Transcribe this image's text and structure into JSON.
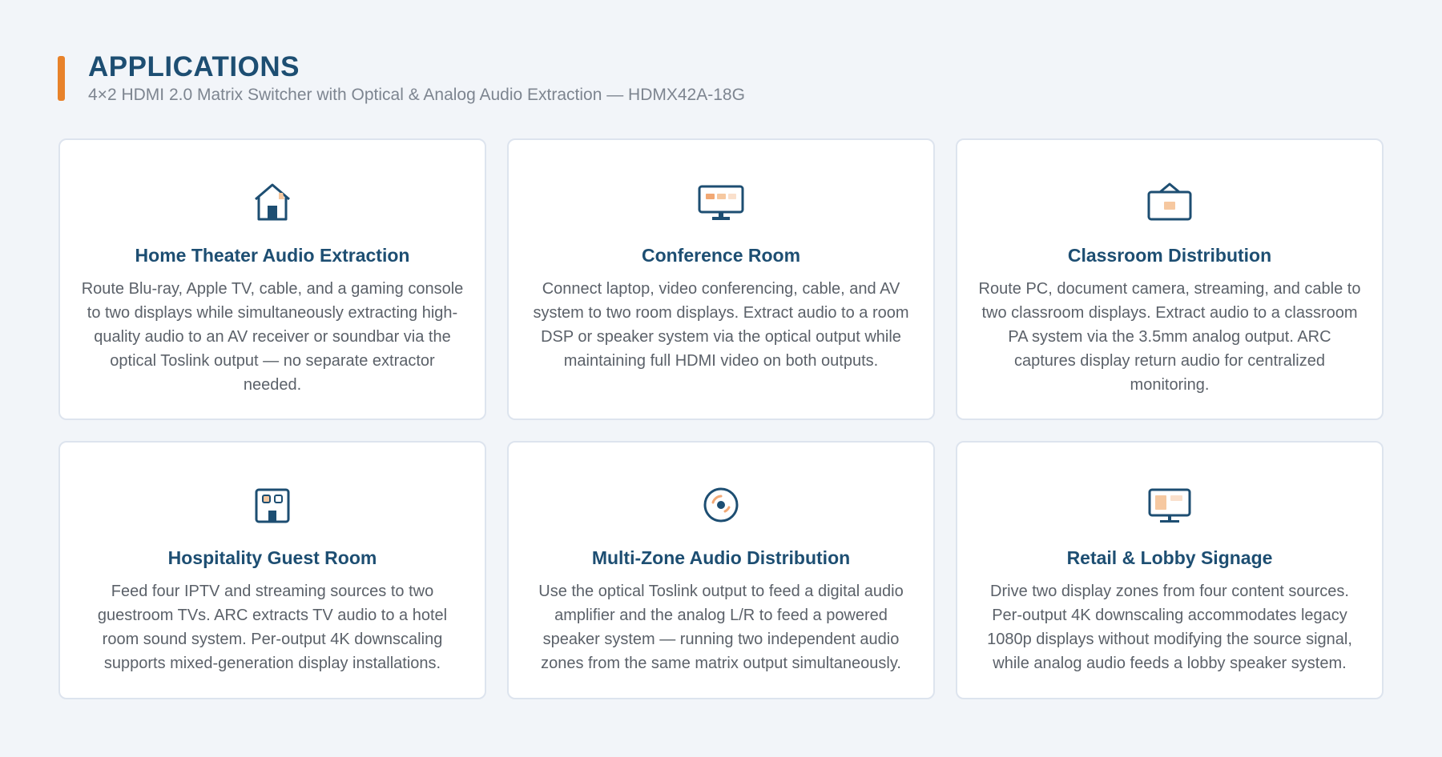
{
  "header": {
    "title": "APPLICATIONS",
    "subtitle": "4×2 HDMI 2.0 Matrix Switcher with Optical & Analog Audio Extraction — HDMX42A-18G"
  },
  "colors": {
    "accent": "#e8822a",
    "navy": "#1d4e72",
    "icon_fill": "#f6c8a0"
  },
  "cards": [
    {
      "icon": "home-icon",
      "title": "Home Theater Audio Extraction",
      "description": "Route Blu-ray, Apple TV, cable, and a gaming console to two displays while simultaneously extracting high-quality audio to an AV receiver or soundbar via the optical Toslink output — no separate extractor needed."
    },
    {
      "icon": "monitor-icon",
      "title": "Conference Room",
      "description": "Connect laptop, video conferencing, cable, and AV system to two room displays. Extract audio to a room DSP or speaker system via the optical output while maintaining full HDMI video on both outputs."
    },
    {
      "icon": "wall-board-icon",
      "title": "Classroom Distribution",
      "description": "Route PC, document camera, streaming, and cable to two classroom displays. Extract audio to a classroom PA system via the 3.5mm analog output. ARC captures display return audio for centralized monitoring."
    },
    {
      "icon": "hotel-icon",
      "title": "Hospitality Guest Room",
      "description": "Feed four IPTV and streaming sources to two guestroom TVs. ARC extracts TV audio to a hotel room sound system. Per-output 4K downscaling supports mixed-generation display installations."
    },
    {
      "icon": "speaker-zone-icon",
      "title": "Multi-Zone Audio Distribution",
      "description": "Use the optical Toslink output to feed a digital audio amplifier and the analog L/R to feed a powered speaker system — running two independent audio zones from the same matrix output simultaneously."
    },
    {
      "icon": "signage-display-icon",
      "title": "Retail & Lobby Signage",
      "description": "Drive two display zones from four content sources. Per-output 4K downscaling accommodates legacy 1080p displays without modifying the source signal, while analog audio feeds a lobby speaker system."
    }
  ]
}
